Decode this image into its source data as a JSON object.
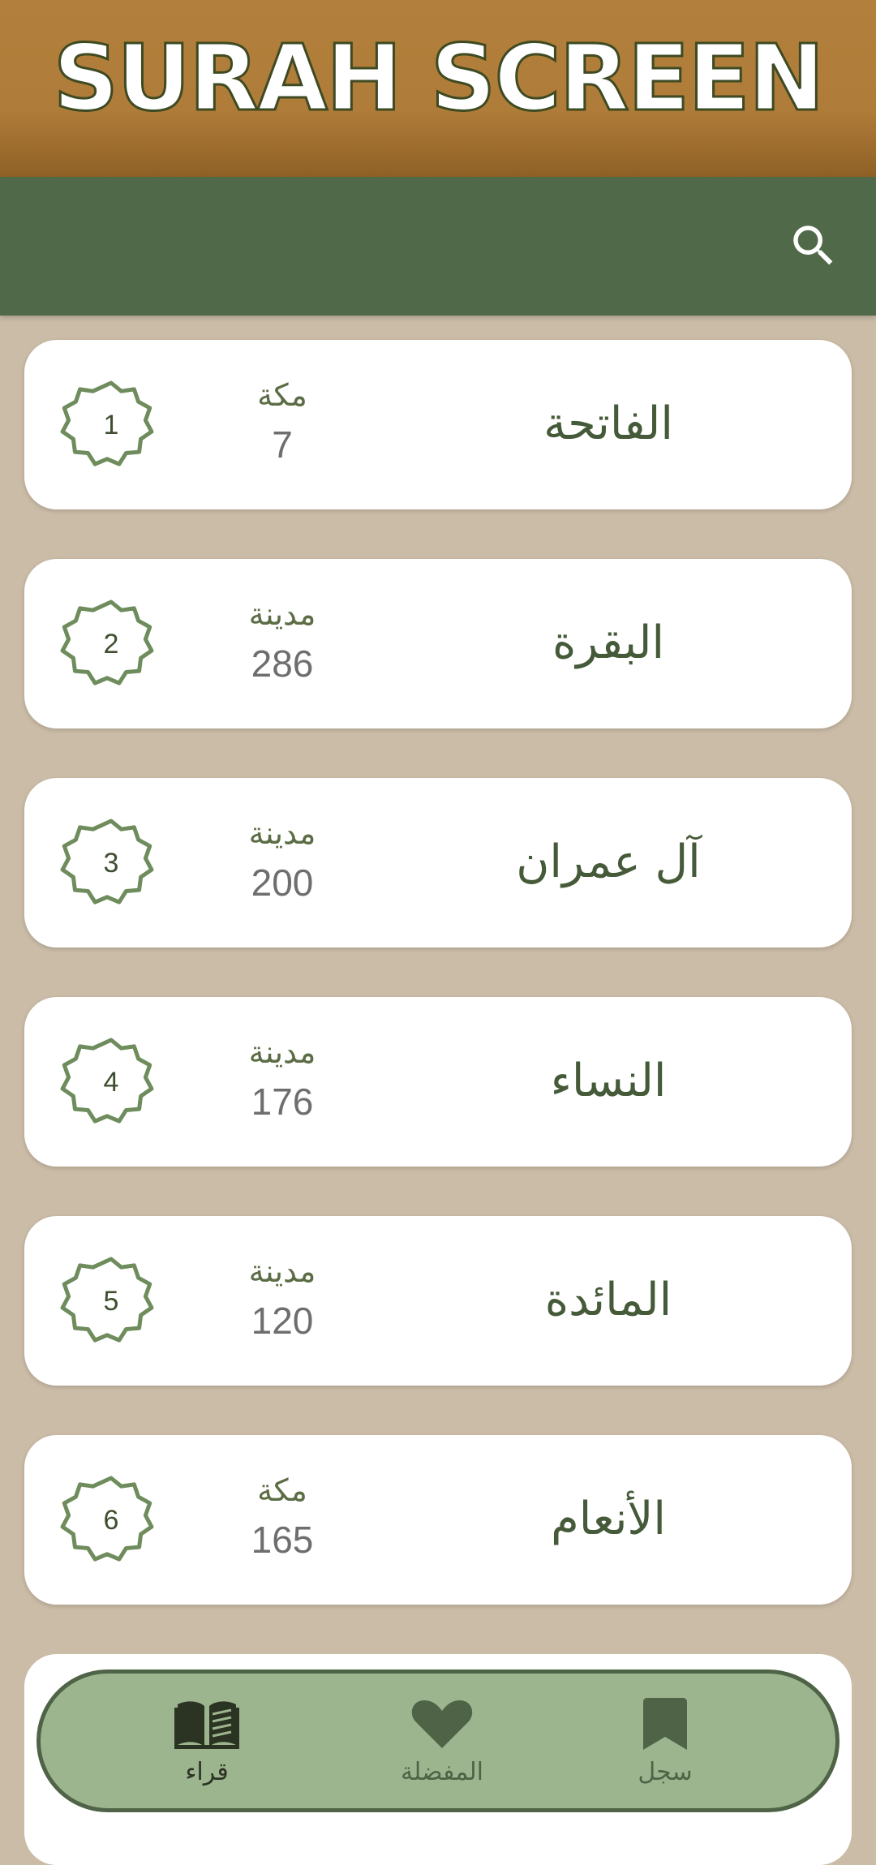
{
  "header": {
    "title": "SURAH SCREEN"
  },
  "appbar": {
    "search_icon": "search-icon"
  },
  "surahs": [
    {
      "number": "1",
      "name": "الفاتحة",
      "place": "مكة",
      "ayahs": "7"
    },
    {
      "number": "2",
      "name": "البقرة",
      "place": "مدينة",
      "ayahs": "286"
    },
    {
      "number": "3",
      "name": "آل عمران",
      "place": "مدينة",
      "ayahs": "200"
    },
    {
      "number": "4",
      "name": "النساء",
      "place": "مدينة",
      "ayahs": "176"
    },
    {
      "number": "5",
      "name": "المائدة",
      "place": "مدينة",
      "ayahs": "120"
    },
    {
      "number": "6",
      "name": "الأنعام",
      "place": "مكة",
      "ayahs": "165"
    }
  ],
  "bottom_nav": {
    "items": [
      {
        "label": "قراء",
        "icon": "open-book-icon",
        "active": true
      },
      {
        "label": "المفضلة",
        "icon": "heart-icon",
        "active": false
      },
      {
        "label": "سجل",
        "icon": "bookmark-icon",
        "active": false
      }
    ]
  },
  "colors": {
    "banner": "#b07c39",
    "appbar": "#506948",
    "background": "#cbbca7",
    "accent_green": "#6e8c5c",
    "nav_background": "#9db58f"
  }
}
